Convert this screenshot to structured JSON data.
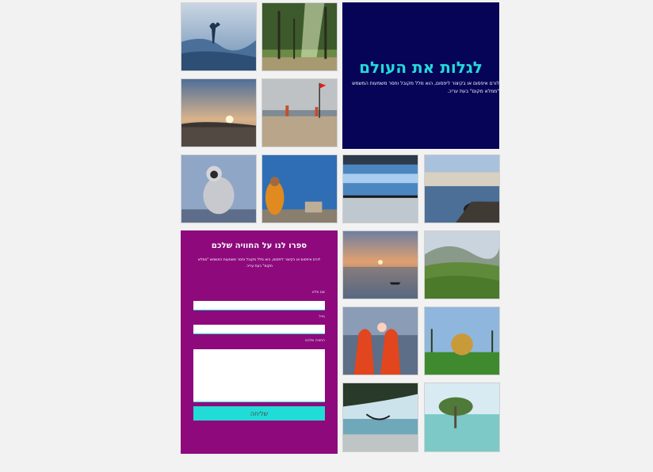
{
  "hero": {
    "title": "לגלות את העולם",
    "text": "לורם איפסום או בקיצור ליפסום, הוא מלל מקובל וחסר משמעות המשמש \"ממלא מקום\" בעת עריכ."
  },
  "form": {
    "title": "ספרו לנו על החוויה שלכם",
    "intro": "לורם איפסום או בקיצור ליפסום, הוא מלל מקובל וחסר משמעות המשמש \"ממלא מקום\" בעת עריכ.",
    "name_label": "שם מלא",
    "email_label": "מייל",
    "experience_label": "החוויה שלכם",
    "name_value": "",
    "email_value": "",
    "experience_value": "",
    "submit_label": "שליחה"
  },
  "gallery": [
    {
      "name": "misty-mountain-photo"
    },
    {
      "name": "palm-forest-photo"
    },
    {
      "name": "sunset-lake-photo"
    },
    {
      "name": "beach-flag-photo"
    },
    {
      "name": "langur-monkey-photo"
    },
    {
      "name": "sadhu-photo"
    },
    {
      "name": "train-photo"
    },
    {
      "name": "ghat-cow-photo"
    },
    {
      "name": "boat-sunset-photo"
    },
    {
      "name": "tea-plantation-photo"
    },
    {
      "name": "two-women-sunset-photo"
    },
    {
      "name": "golden-dome-photo"
    },
    {
      "name": "hammock-beach-photo"
    },
    {
      "name": "mangrove-photo"
    }
  ]
}
